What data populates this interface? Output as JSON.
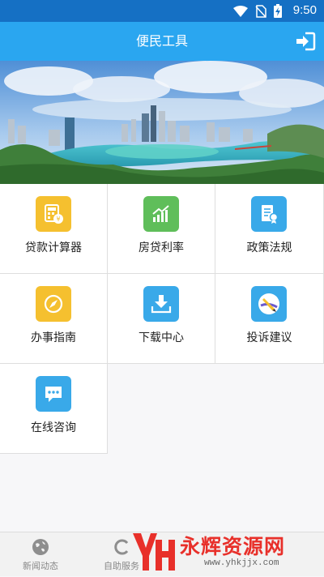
{
  "status_bar": {
    "time": "9:50",
    "icons": [
      "wifi-icon",
      "no-sim-icon",
      "battery-charging-icon"
    ]
  },
  "header": {
    "title": "便民工具",
    "action_icon": "logout-icon"
  },
  "banner": {
    "image": "city-skyline-lake-photo"
  },
  "tools": [
    {
      "label": "贷款计算器",
      "icon": "calculator-icon",
      "color": "#f5c02f"
    },
    {
      "label": "房贷利率",
      "icon": "bar-chart-icon",
      "color": "#5fbe5a"
    },
    {
      "label": "政策法规",
      "icon": "policy-document-icon",
      "color": "#39a9e9"
    },
    {
      "label": "办事指南",
      "icon": "compass-icon",
      "color": "#f5c02f"
    },
    {
      "label": "下载中心",
      "icon": "download-icon",
      "color": "#39a9e9"
    },
    {
      "label": "投诉建议",
      "icon": "pen-icon",
      "color": "#39a9e9"
    },
    {
      "label": "在线咨询",
      "icon": "chat-icon",
      "color": "#39a9e9"
    }
  ],
  "tabbar": {
    "tabs": [
      {
        "label": "新闻动态",
        "icon": "globe-icon"
      },
      {
        "label": "自助服务",
        "icon": "service-icon"
      }
    ]
  },
  "watermark": {
    "text": "永辉资源网",
    "url": "www.yhkjjx.com"
  }
}
